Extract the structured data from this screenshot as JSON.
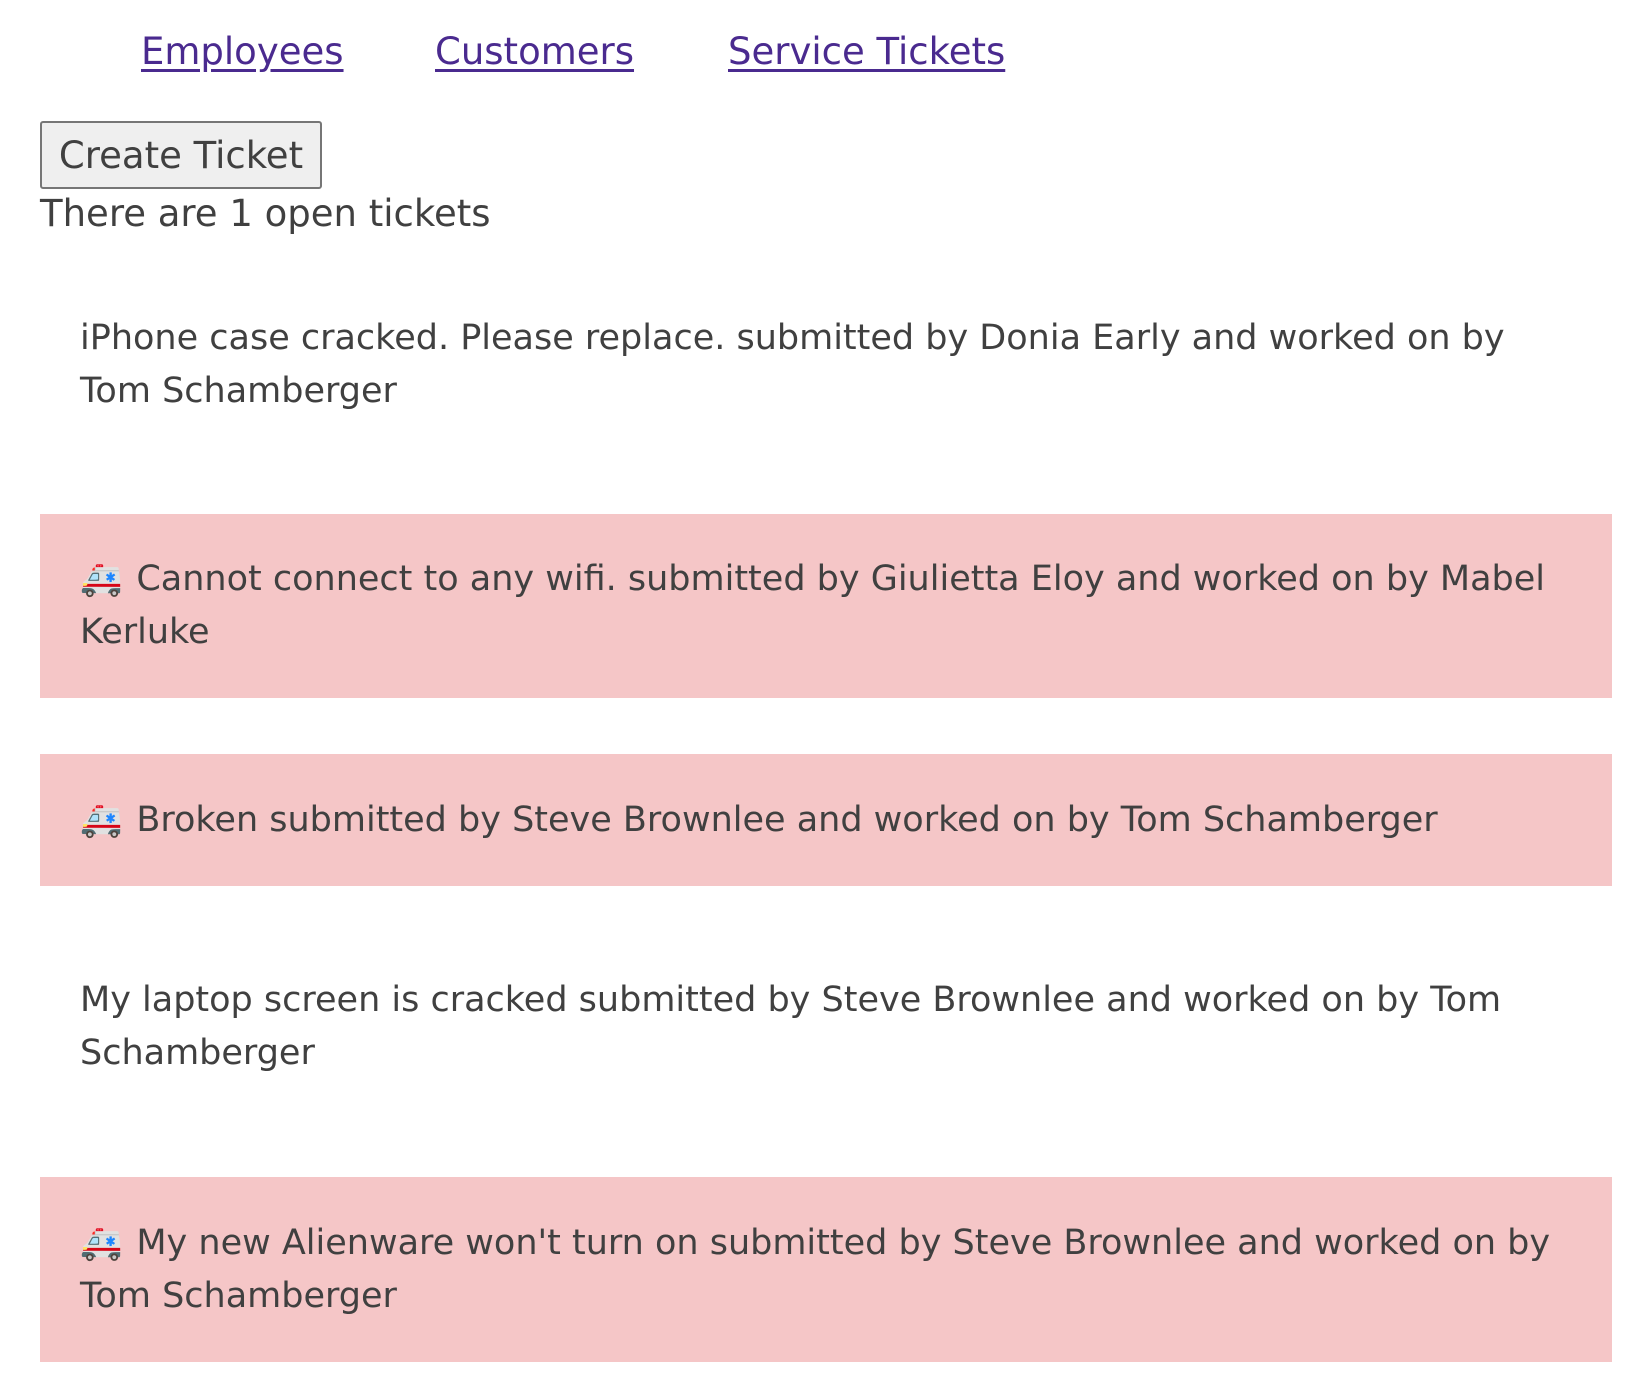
{
  "nav": {
    "links": [
      {
        "label": "Employees"
      },
      {
        "label": "Customers"
      },
      {
        "label": "Service Tickets"
      }
    ]
  },
  "create_button": {
    "label": "Create Ticket"
  },
  "open_count_text": "There are 1 open tickets",
  "emergency_icon": "ambulance-icon",
  "emergency_color": "#f5c6c7",
  "tickets": [
    {
      "emergency": false,
      "text": "iPhone case cracked. Please replace. submitted by Donia Early and worked on by Tom Schamberger"
    },
    {
      "emergency": true,
      "text": "Cannot connect to any wifi. submitted by Giulietta Eloy and worked on by Mabel Kerluke"
    },
    {
      "emergency": true,
      "text": "Broken submitted by Steve Brownlee and worked on by Tom Schamberger"
    },
    {
      "emergency": false,
      "text": "My laptop screen is cracked submitted by Steve Brownlee and worked on by Tom Schamberger"
    },
    {
      "emergency": true,
      "text": "My new Alienware won't turn on submitted by Steve Brownlee and worked on by Tom Schamberger"
    }
  ]
}
